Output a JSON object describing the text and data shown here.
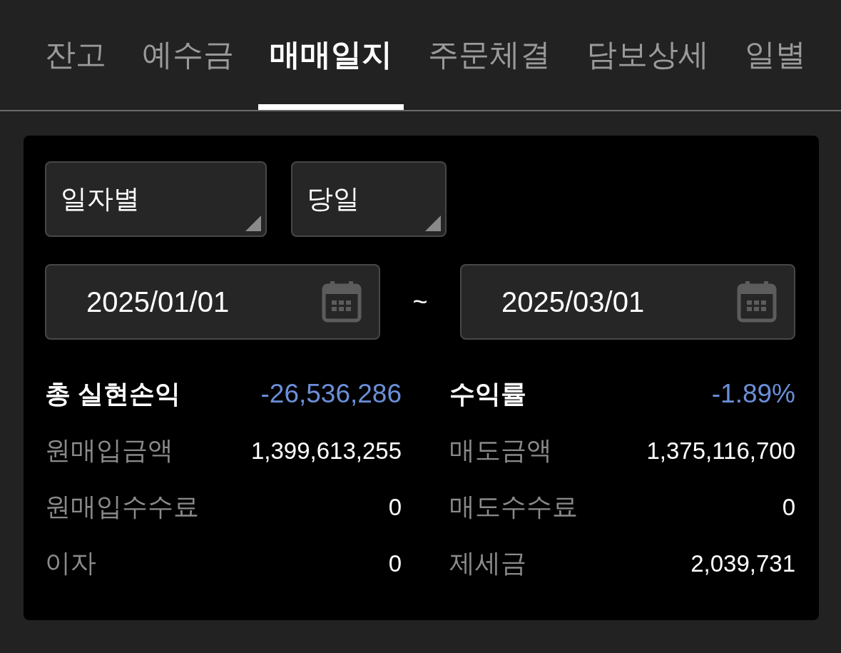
{
  "tabs": [
    {
      "label": "잔고",
      "selected": false
    },
    {
      "label": "예수금",
      "selected": false
    },
    {
      "label": "매매일지",
      "selected": true
    },
    {
      "label": "주문체결",
      "selected": false
    },
    {
      "label": "담보상세",
      "selected": false
    },
    {
      "label": "일별",
      "selected": false
    }
  ],
  "filters": [
    {
      "value": "일자별"
    },
    {
      "value": "당일"
    }
  ],
  "date_range": {
    "start": "2025/01/01",
    "separator": "~",
    "end": "2025/03/01"
  },
  "metrics": [
    {
      "label": "총 실현손익",
      "value": "-26,536,286",
      "kind": "total"
    },
    {
      "label": "수익률",
      "value": "-1.89%",
      "kind": "total"
    },
    {
      "label": "원매입금액",
      "value": "1,399,613,255",
      "kind": "detail"
    },
    {
      "label": "매도금액",
      "value": "1,375,116,700",
      "kind": "detail"
    },
    {
      "label": "원매입수수료",
      "value": "0",
      "kind": "detail"
    },
    {
      "label": "매도수수료",
      "value": "0",
      "kind": "detail"
    },
    {
      "label": "이자",
      "value": "0",
      "kind": "detail"
    },
    {
      "label": "제세금",
      "value": "2,039,731",
      "kind": "detail"
    }
  ]
}
